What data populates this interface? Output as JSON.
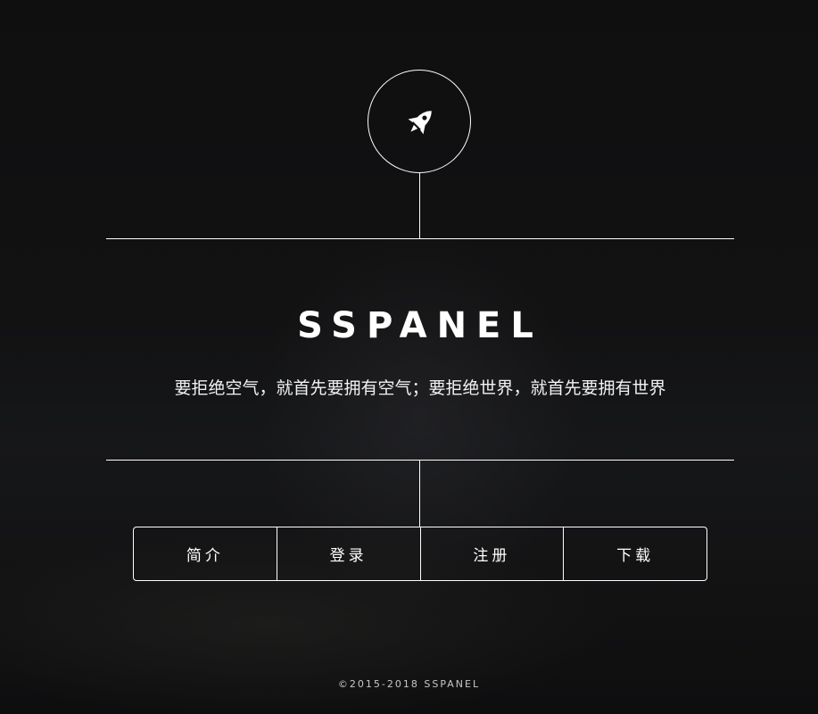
{
  "header": {
    "logo_icon": "rocket-icon"
  },
  "main": {
    "title": "SSPANEL",
    "subtitle": "要拒绝空气，就首先要拥有空气；要拒绝世界，就首先要拥有世界"
  },
  "nav": {
    "items": [
      {
        "label": "简介"
      },
      {
        "label": "登录"
      },
      {
        "label": "注册"
      },
      {
        "label": "下载"
      }
    ]
  },
  "footer": {
    "copyright": "©2015-2018 SSPANEL"
  },
  "colors": {
    "background": "#101011",
    "foreground": "#ffffff"
  }
}
